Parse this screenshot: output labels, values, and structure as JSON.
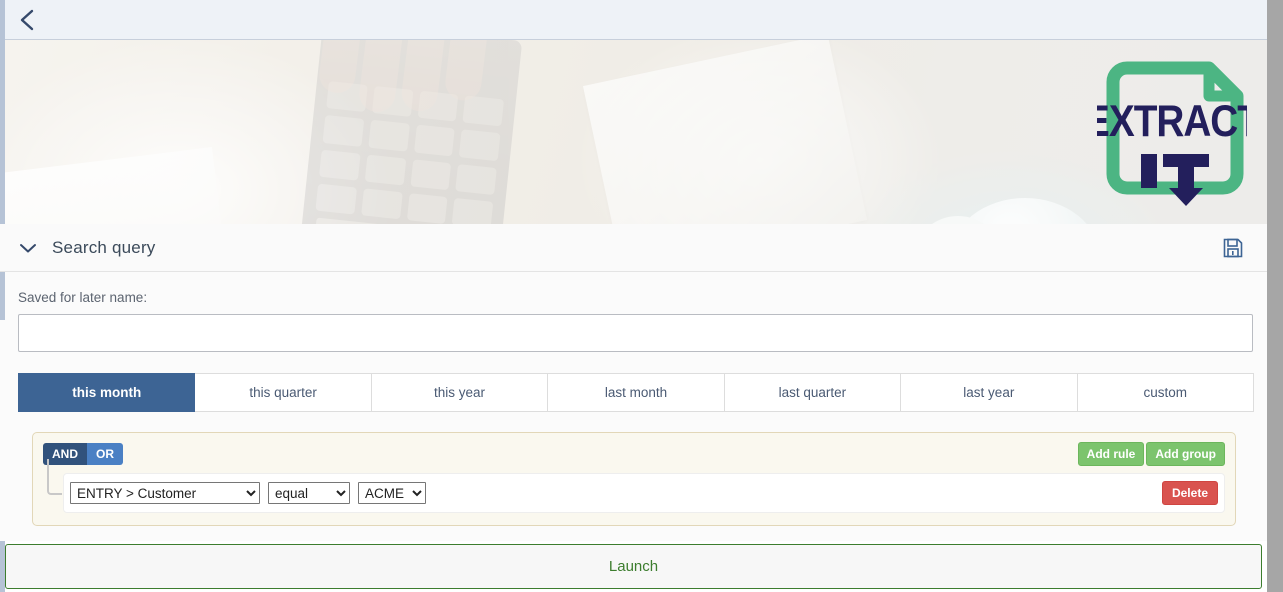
{
  "topbar": {
    "back_icon": "chevron-left-icon"
  },
  "banner": {
    "logo": {
      "line1": "EXTRACT",
      "line2": "IT",
      "green": "#4cb583",
      "navy": "#231f5c",
      "alt": "extract-it-logo"
    },
    "image_alt": "hand-using-calculator-with-documents"
  },
  "panel": {
    "collapse_icon": "chevron-down-icon",
    "title": "Search query",
    "save_icon": "floppy-disk-save-icon",
    "saved_name": {
      "label": "Saved for later name:",
      "value": "",
      "placeholder": ""
    }
  },
  "period_tabs": {
    "active_index": 0,
    "items": [
      {
        "label": "this month"
      },
      {
        "label": "this quarter"
      },
      {
        "label": "this year"
      },
      {
        "label": "last month"
      },
      {
        "label": "last quarter"
      },
      {
        "label": "last year"
      },
      {
        "label": "custom"
      }
    ]
  },
  "query_builder": {
    "condition": {
      "and_label": "AND",
      "or_label": "OR",
      "active": "AND"
    },
    "actions": {
      "add_rule_label": "Add rule",
      "add_group_label": "Add group"
    },
    "rules": [
      {
        "field": {
          "value": "ENTRY > Customer",
          "options": [
            "ENTRY > Customer"
          ]
        },
        "operator": {
          "value": "equal",
          "options": [
            "equal"
          ]
        },
        "value": {
          "value": "ACME",
          "options": [
            "ACME"
          ]
        },
        "delete_label": "Delete"
      }
    ]
  },
  "footer": {
    "launch_label": "Launch"
  },
  "colors": {
    "active_tab": "#3d6494",
    "accent_green": "#7cc46d",
    "delete_red": "#d9534f",
    "launch_green": "#3c7d2e",
    "group_bg": "#faf8ef",
    "group_border": "#e2d7b8"
  }
}
